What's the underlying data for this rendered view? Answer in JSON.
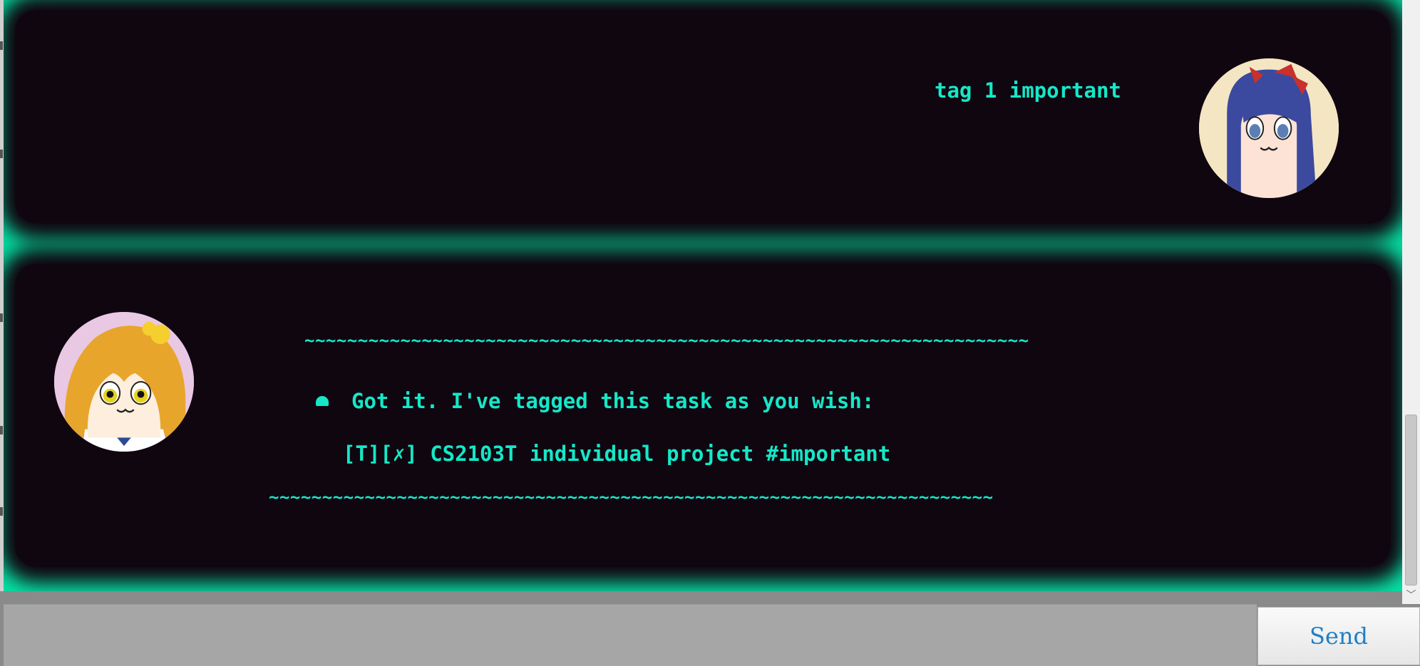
{
  "chat": {
    "user_message": "tag 1 important",
    "bot": {
      "separator_top": "~~~~~~~~~~~~~~~~~~~~~~~~~~~~~~~~~~~~~~~~~~~~~~~~~~~~~~~~~~~~~~~~~~~~",
      "line_1": "Got it. I've tagged this task as you wish:",
      "line_2": "[T][✗] CS2103T individual project #important",
      "separator_bottom": "~~~~~~~~~~~~~~~~~~~~~~~~~~~~~~~~~~~~~~~~~~~~~~~~~~~~~~~~~~~~~~~~~~~~"
    }
  },
  "input": {
    "value": "",
    "placeholder": ""
  },
  "send_label": "Send",
  "icons": {
    "user_avatar": "user-avatar-icon",
    "bot_avatar": "bot-avatar-icon",
    "bullet": "bullet-icon",
    "scroll_down": "chevron-down-icon"
  },
  "colors": {
    "accent": "#07e0a4",
    "card_background": "#100610",
    "message_text": "#14e8c8",
    "send_text": "#1f7fc4"
  }
}
